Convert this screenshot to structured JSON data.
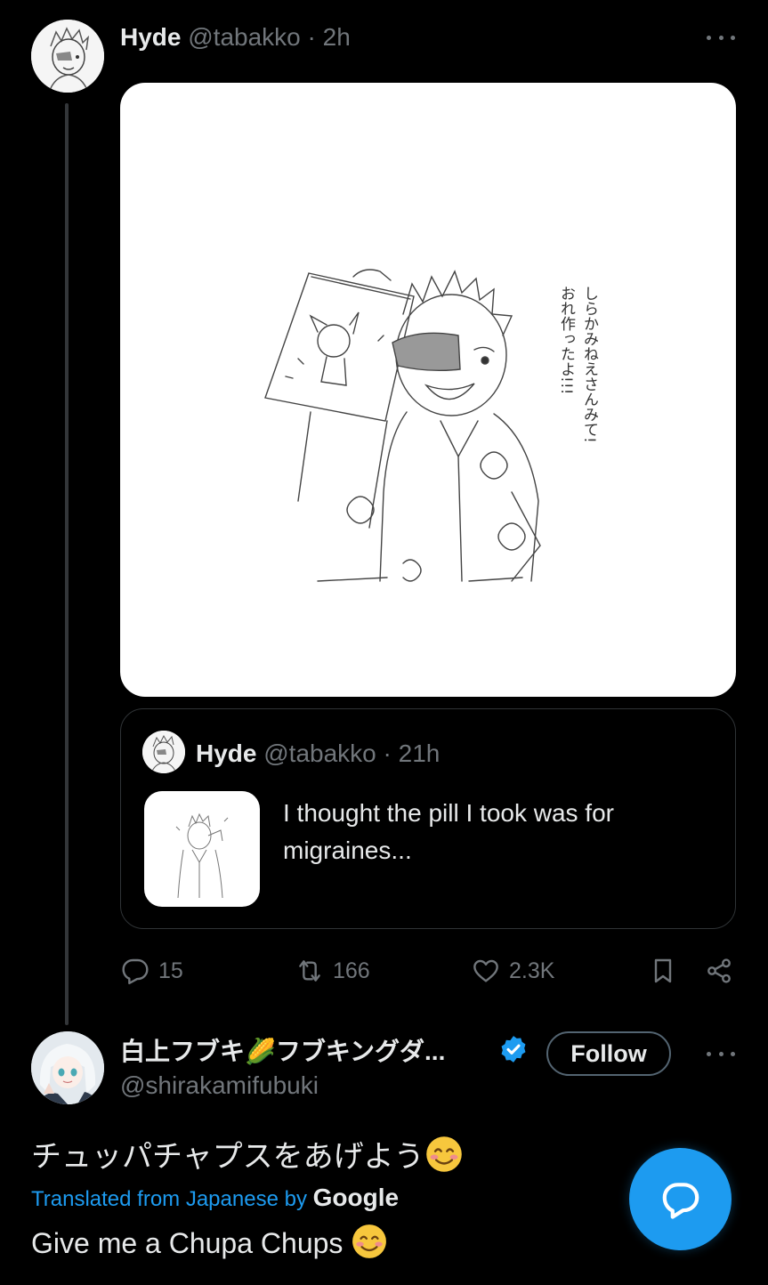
{
  "tweet1": {
    "display_name": "Hyde",
    "handle": "@tabakko",
    "separator": "·",
    "time": "2h",
    "media": {
      "caption_lines": [
        "しらかみねえさんみて!",
        "おれ作ったよ!!!"
      ]
    },
    "quote": {
      "display_name": "Hyde",
      "handle": "@tabakko",
      "separator": "·",
      "time": "21h",
      "text_line1": "I thought the pill I took was for",
      "text_line2": "migraines..."
    },
    "actions": {
      "replies": "15",
      "retweets": "166",
      "likes": "2.3K"
    }
  },
  "tweet2": {
    "display_name": "白上フブキ🌽フブキングダ...",
    "handle": "@shirakamifubuki",
    "verified": true,
    "follow_label": "Follow",
    "text_jp": "チュッパチャプスをあげよう",
    "translated_label": "Translated from Japanese by",
    "translator": "Google",
    "text_en": "Give me a Chupa Chups"
  },
  "colors": {
    "background": "#000000",
    "text": "#e7e9ea",
    "muted": "#71767b",
    "accent": "#1d9bf0",
    "border": "#2f3336"
  },
  "icons": [
    "more-icon",
    "reply-icon",
    "retweet-icon",
    "like-icon",
    "bookmark-icon",
    "share-icon",
    "verified-icon",
    "compose-reply-icon",
    "smiling-emoji-icon",
    "corn-emoji-icon"
  ]
}
